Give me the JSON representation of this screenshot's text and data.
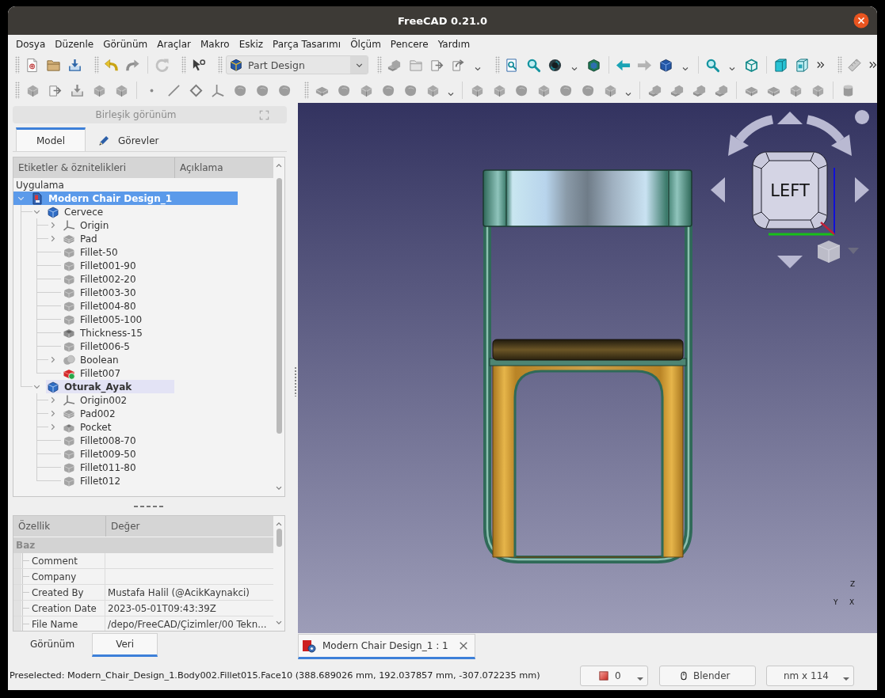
{
  "window": {
    "title": "FreeCAD 0.21.0"
  },
  "menu_bar": [
    "Dosya",
    "Düzenle",
    "Görünüm",
    "Araçlar",
    "Makro",
    "Eskiz",
    "Parça Tasarımı",
    "Ölçüm",
    "Pencere",
    "Yardım"
  ],
  "toolbar": {
    "workbench": "Part Design"
  },
  "combo_view": {
    "title": "Birleşik görünüm",
    "tabs": [
      {
        "label": "Model",
        "selected": true
      },
      {
        "label": "Görevler",
        "selected": false
      }
    ]
  },
  "tree": {
    "columns": [
      "Etiketler & öznitelikleri",
      "Açıklama"
    ],
    "root": "Uygulama",
    "items": [
      {
        "label": "Modern Chair Design_1",
        "kind": "document",
        "expanded": true,
        "selected": true,
        "active": true,
        "highlighted": false,
        "children": [
          {
            "label": "Cervece",
            "kind": "body",
            "expanded": true,
            "selected": false,
            "active": false,
            "highlighted": false,
            "children": [
              {
                "label": "Origin",
                "kind": "origin",
                "expanded": false,
                "selected": false,
                "active": false,
                "highlighted": false
              },
              {
                "label": "Pad",
                "kind": "pad",
                "expanded": false,
                "selected": false,
                "active": false,
                "highlighted": false
              },
              {
                "label": "Fillet-50",
                "kind": "fillet",
                "selected": false,
                "active": false,
                "highlighted": false
              },
              {
                "label": "Fillet001-90",
                "kind": "fillet",
                "selected": false,
                "active": false,
                "highlighted": false
              },
              {
                "label": "Fillet002-20",
                "kind": "fillet",
                "selected": false,
                "active": false,
                "highlighted": false
              },
              {
                "label": "Fillet003-30",
                "kind": "fillet",
                "selected": false,
                "active": false,
                "highlighted": false
              },
              {
                "label": "Fillet004-80",
                "kind": "fillet",
                "selected": false,
                "active": false,
                "highlighted": false
              },
              {
                "label": "Fillet005-100",
                "kind": "fillet",
                "selected": false,
                "active": false,
                "highlighted": false
              },
              {
                "label": "Thickness-15",
                "kind": "thickness",
                "selected": false,
                "active": false,
                "highlighted": false
              },
              {
                "label": "Fillet006-5",
                "kind": "fillet",
                "selected": false,
                "active": false,
                "highlighted": false
              },
              {
                "label": "Boolean",
                "kind": "boolean",
                "expanded": false,
                "selected": false,
                "active": false,
                "highlighted": false
              },
              {
                "label": "Fillet007",
                "kind": "failed",
                "selected": false,
                "active": false,
                "highlighted": false
              }
            ]
          },
          {
            "label": "Oturak_Ayak",
            "kind": "body",
            "expanded": true,
            "selected": false,
            "active": true,
            "highlighted": true,
            "children": [
              {
                "label": "Origin002",
                "kind": "origin",
                "expanded": false,
                "selected": false,
                "active": false,
                "highlighted": false
              },
              {
                "label": "Pad002",
                "kind": "pad",
                "expanded": false,
                "selected": false,
                "active": false,
                "highlighted": false
              },
              {
                "label": "Pocket",
                "kind": "pocket",
                "expanded": false,
                "selected": false,
                "active": false,
                "highlighted": false
              },
              {
                "label": "Fillet008-70",
                "kind": "fillet",
                "selected": false,
                "active": false,
                "highlighted": false
              },
              {
                "label": "Fillet009-50",
                "kind": "fillet",
                "selected": false,
                "active": false,
                "highlighted": false
              },
              {
                "label": "Fillet011-80",
                "kind": "fillet",
                "selected": false,
                "active": false,
                "highlighted": false
              },
              {
                "label": "Fillet012",
                "kind": "fillet",
                "selected": false,
                "active": false,
                "highlighted": false
              }
            ]
          }
        ]
      }
    ]
  },
  "property_view": {
    "columns": [
      "Özellik",
      "Değer"
    ],
    "group": "Baz",
    "rows": [
      {
        "name": "Comment"
      },
      {
        "name": "Company"
      },
      {
        "name": "Created By",
        "value": "Mustafa Halil (@AcikKaynakci)"
      },
      {
        "name": "Creation Date",
        "value": "2023-05-01T09:43:39Z"
      },
      {
        "name": "File Name",
        "value": "/depo/FreeCAD/Çizimler/00 Tekn..."
      }
    ],
    "tabs": [
      {
        "label": "Görünüm",
        "selected": false
      },
      {
        "label": "Veri",
        "selected": true
      }
    ]
  },
  "view_3d": {
    "navigation_cube": {
      "face": "LEFT"
    },
    "axis_labels": [
      "Z",
      "Y",
      "X"
    ]
  },
  "document_tabs": [
    {
      "label": "Modern Chair Design_1 : 1",
      "selected": true
    }
  ],
  "status_bar": {
    "message": "Preselected: Modern_Chair_Design_1.Body002.Fillet015.Face10 (388.689026 mm, 192.037857 mm, -307.072235 mm)",
    "counter": "0",
    "navigation_style": "Blender",
    "units": "nm x 114"
  }
}
